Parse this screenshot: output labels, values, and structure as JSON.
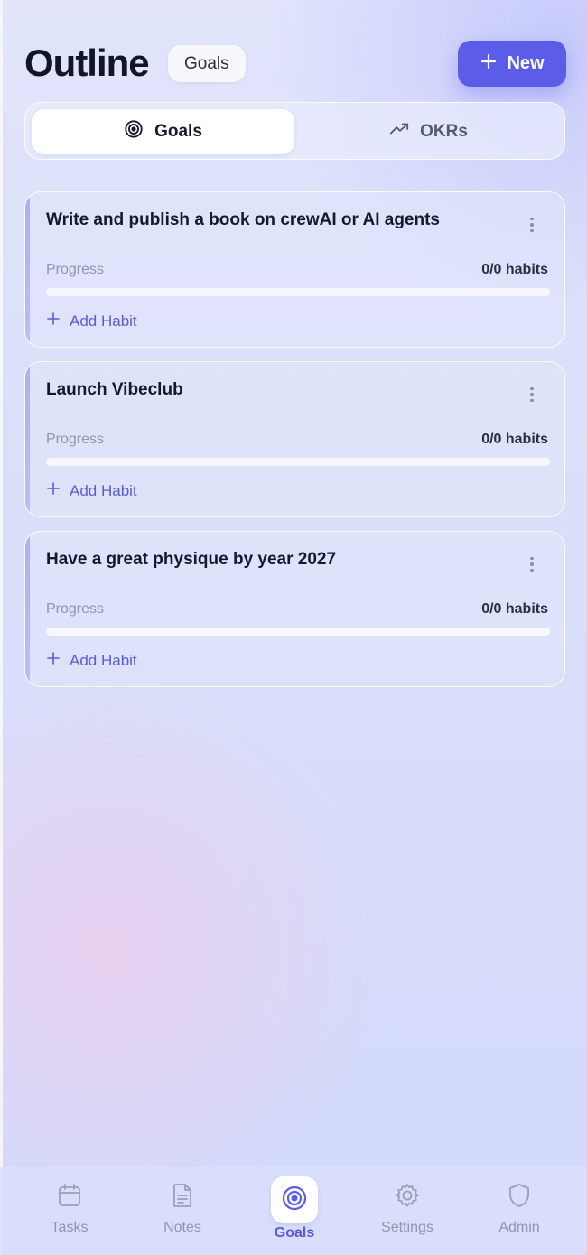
{
  "header": {
    "title": "Outline",
    "badge": "Goals",
    "new_button_label": "New"
  },
  "segment": {
    "tabs": [
      {
        "label": "Goals",
        "icon": "target-icon",
        "active": true
      },
      {
        "label": "OKRs",
        "icon": "trending-up-icon",
        "active": false
      }
    ]
  },
  "goals": [
    {
      "title": "Write and publish a book on crewAI or AI agents",
      "progress_label": "Progress",
      "progress_count": "0/0 habits",
      "progress": 0,
      "add_label": "Add Habit"
    },
    {
      "title": "Launch Vibeclub",
      "progress_label": "Progress",
      "progress_count": "0/0 habits",
      "progress": 0,
      "add_label": "Add Habit"
    },
    {
      "title": "Have a great physique by year 2027",
      "progress_label": "Progress",
      "progress_count": "0/0 habits",
      "progress": 0,
      "add_label": "Add Habit"
    }
  ],
  "nav": {
    "items": [
      {
        "label": "Tasks",
        "icon": "calendar-icon",
        "active": false
      },
      {
        "label": "Notes",
        "icon": "document-icon",
        "active": false
      },
      {
        "label": "Goals",
        "icon": "target-icon",
        "active": true
      },
      {
        "label": "Settings",
        "icon": "gear-icon",
        "active": false
      },
      {
        "label": "Admin",
        "icon": "shield-icon",
        "active": false
      }
    ]
  },
  "colors": {
    "accent": "#5b5ce8",
    "accent_text": "#5a5cd6",
    "muted_text": "#9196aa",
    "title_text": "#12152a"
  }
}
